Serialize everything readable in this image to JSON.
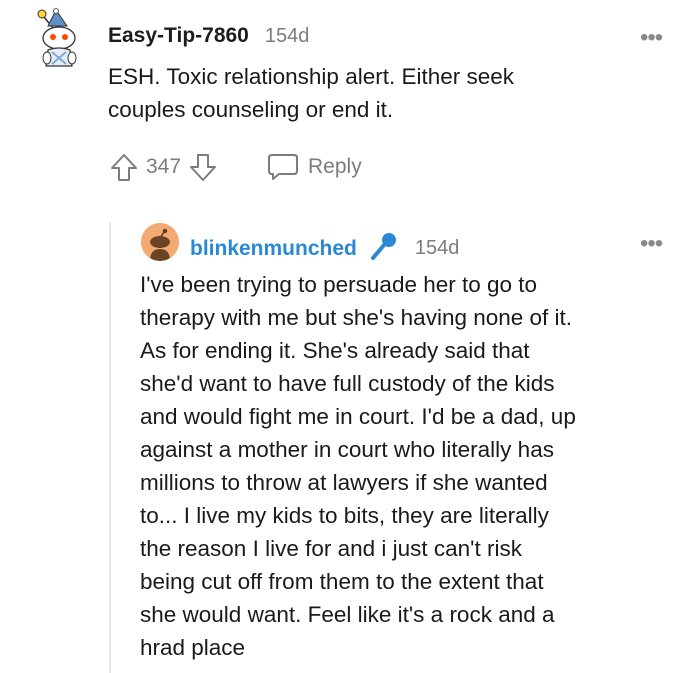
{
  "comment": {
    "username": "Easy-Tip-7860",
    "age": "154d",
    "body_lines": [
      "ESH. Toxic relationship alert. Either seek",
      "couples counseling or end it."
    ],
    "vote_count": "347",
    "reply_label": "Reply",
    "more_label": "•••"
  },
  "reply": {
    "username": "blinkenmunched",
    "age": "154d",
    "more_label": "•••",
    "body_lines": [
      "I've been trying to persuade her to go to",
      "therapy with me but she's having none of it.",
      "As for ending it. She's already said that",
      "she'd want to have full custody of the kids",
      "and would fight me in court. I'd be a dad, up",
      "against a mother in court who literally has",
      "millions to throw at lawyers if she wanted",
      "to... I live my kids to bits, they are literally",
      "the reason I live for and i just can't risk",
      "being cut off from them to the extent that",
      "she would want. Feel like it's a rock and a",
      "hrad place"
    ]
  },
  "colors": {
    "username_reply": "#2a88d4",
    "muted": "#7c7c7c",
    "thread_line": "#e7e7e9"
  }
}
